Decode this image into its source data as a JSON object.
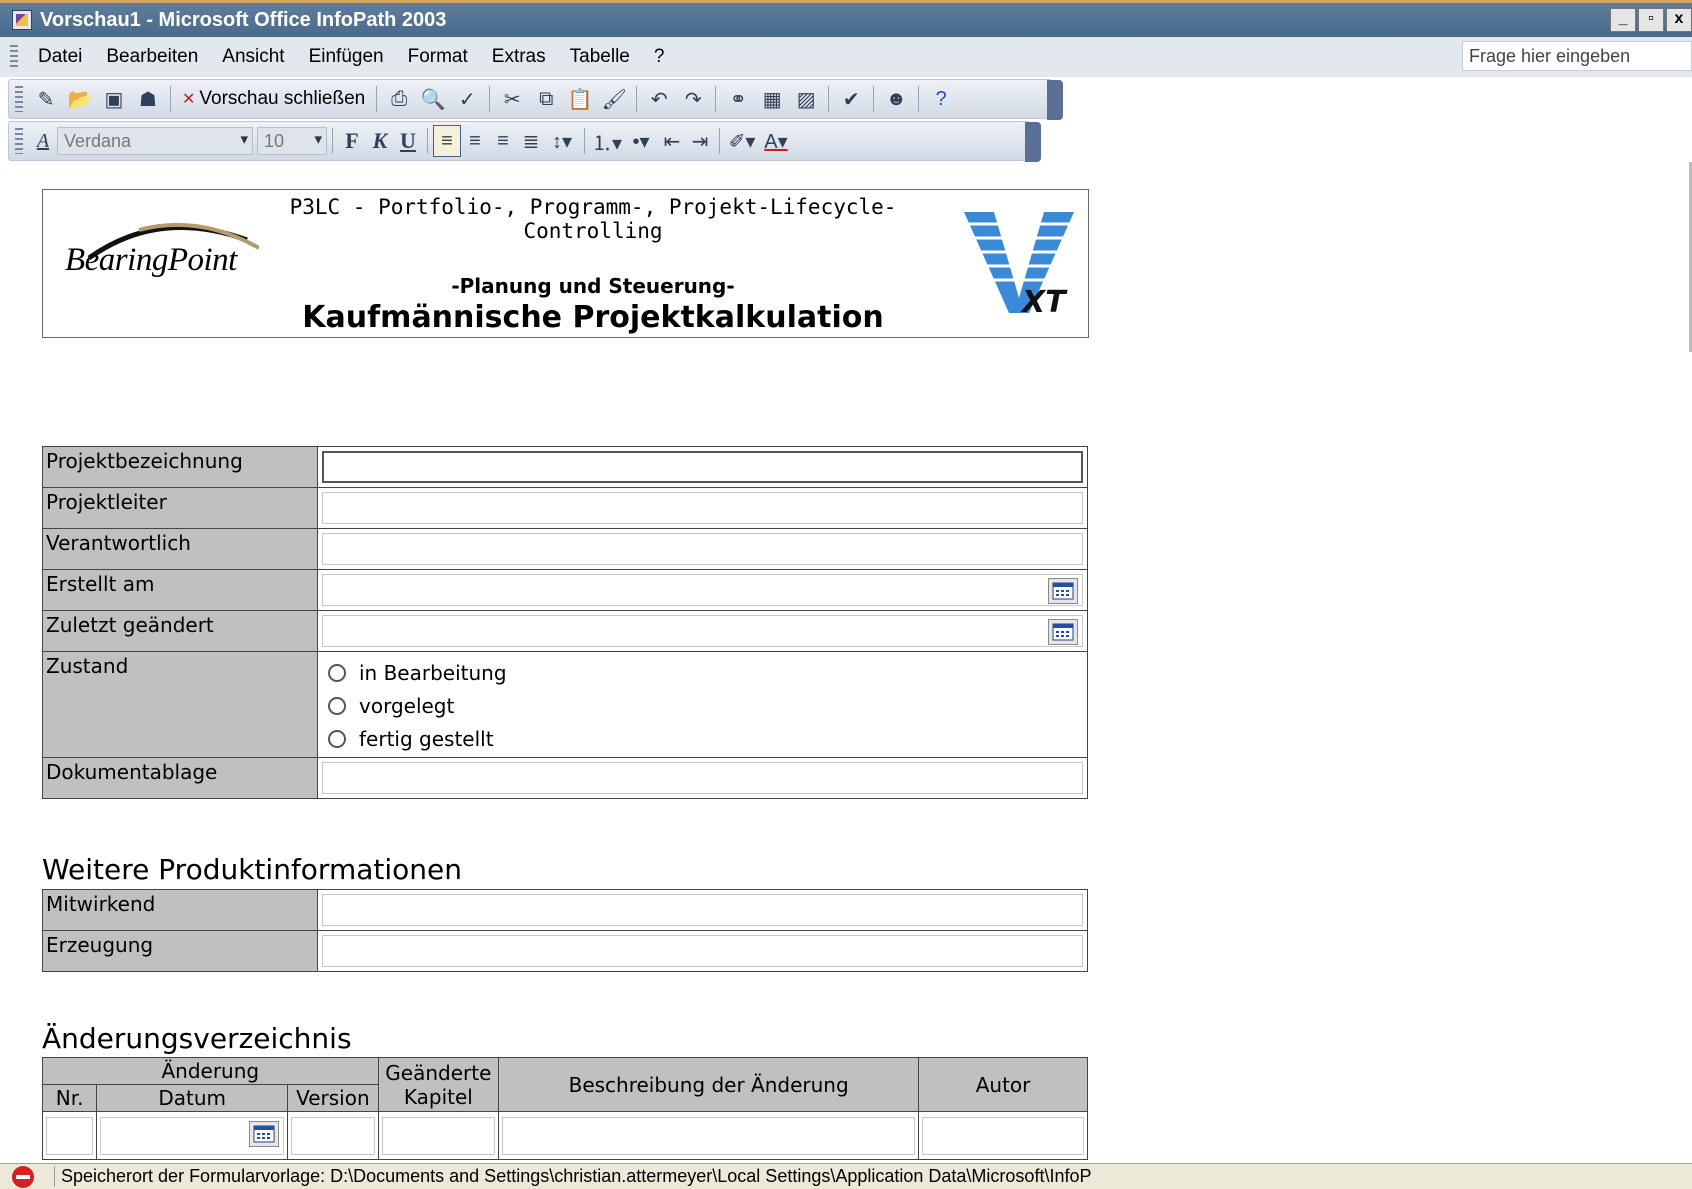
{
  "window": {
    "title": "Vorschau1 - Microsoft Office InfoPath 2003",
    "controls": [
      "_",
      "▫",
      "x"
    ]
  },
  "menu": {
    "items": [
      {
        "label": "Datei",
        "key": "D"
      },
      {
        "label": "Bearbeiten",
        "key": "B"
      },
      {
        "label": "Ansicht",
        "key": "A"
      },
      {
        "label": "Einfügen",
        "key": "E"
      },
      {
        "label": "Format",
        "key": "t"
      },
      {
        "label": "Extras",
        "key": "x"
      },
      {
        "label": "Tabelle",
        "key": "l"
      },
      {
        "label": "?",
        "key": "?"
      }
    ],
    "help_placeholder": "Frage hier eingeben"
  },
  "toolbar": {
    "close_preview_label": "Vorschau schließen",
    "font_name": "Verdana",
    "font_size": "10",
    "bold": "F",
    "italic": "K",
    "underline": "U"
  },
  "header": {
    "company": "BearingPoint",
    "line1": "P3LC - Portfolio-, Programm-, Projekt-Lifecycle-Controlling",
    "line2": "-Planung und Steuerung-",
    "line3": "Kaufmännische Projektkalkulation",
    "logo_text": "XT"
  },
  "form": {
    "fields": [
      {
        "label": "Projektbezeichnung",
        "value": ""
      },
      {
        "label": "Projektleiter",
        "value": ""
      },
      {
        "label": "Verantwortlich",
        "value": ""
      },
      {
        "label": "Erstellt am",
        "value": ""
      },
      {
        "label": "Zuletzt geändert",
        "value": ""
      },
      {
        "label": "Zustand",
        "options": [
          "in Bearbeitung",
          "vorgelegt",
          "fertig gestellt"
        ]
      },
      {
        "label": "Dokumentablage",
        "value": ""
      }
    ]
  },
  "more_info": {
    "title": "Weitere Produktinformationen",
    "fields": [
      {
        "label": "Mitwirkend",
        "value": ""
      },
      {
        "label": "Erzeugung",
        "value": ""
      }
    ]
  },
  "changes": {
    "title": "Änderungsverzeichnis",
    "group_header": "Änderung",
    "col_nr": "Nr.",
    "col_datum": "Datum",
    "col_version": "Version",
    "col_kapitel": "Geänderte Kapitel",
    "col_beschreibung": "Beschreibung der Änderung",
    "col_autor": "Autor"
  },
  "status": {
    "text": "Speicherort der Formularvorlage: D:\\Documents and Settings\\christian.attermeyer\\Local Settings\\Application Data\\Microsoft\\InfoP"
  },
  "colors": {
    "titlebar": "#4a6a8c",
    "label_bg": "#c0c0c0",
    "toolbar": "#d3dae6"
  }
}
